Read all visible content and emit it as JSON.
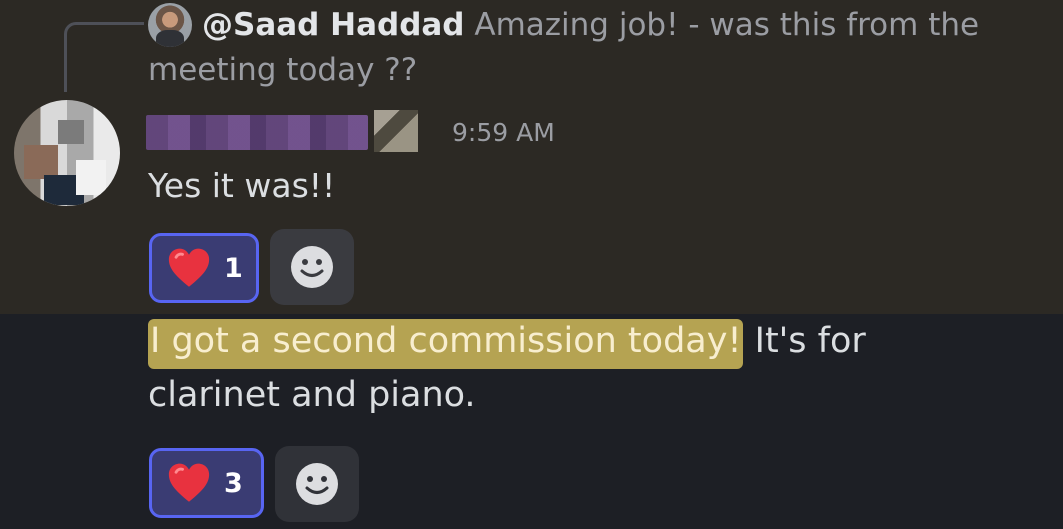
{
  "reply": {
    "mention": "@Saad Haddad",
    "text": "Amazing job! - was this from the meeting today ??"
  },
  "message1": {
    "timestamp": "9:59 AM",
    "text": "Yes it was!!",
    "reaction": {
      "emoji": "heart-icon",
      "count": "1"
    }
  },
  "message2": {
    "highlighted": "I got a second commission today!",
    "rest": "It's for clarinet and piano.",
    "reaction": {
      "emoji": "heart-icon",
      "count": "3"
    }
  },
  "colors": {
    "highlight": "#b5a352",
    "reaction_active_border": "#5865f2",
    "top_message_bg": "#2c2924",
    "page_bg": "#1d1f25"
  }
}
